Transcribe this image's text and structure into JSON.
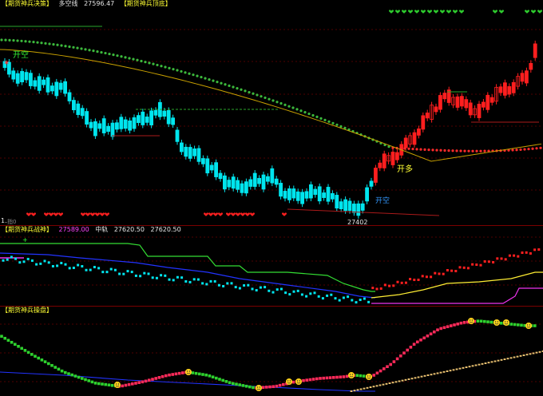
{
  "panel1": {
    "title": "【期货神兵决策】",
    "indicator_label": "多空线",
    "indicator_value": "27596.47",
    "subtitle": "【期货神兵顶底】",
    "open_short_label": "开空",
    "open_short_label_2": "开空",
    "open_long_label": "开多",
    "low_price_label": "27402",
    "corner_label": "1.",
    "corner_label_2": "指0"
  },
  "panel2": {
    "title": "【期货神兵战神】",
    "value1": "27589.00",
    "mid_label": "中轨",
    "mid_value": "27620.50",
    "value3": "27620.50"
  },
  "panel3": {
    "title": "【期货神兵操盘】"
  },
  "colors": {
    "up": "#ff1f1f",
    "down": "#00e5ee",
    "ma_green": "#3cb83c",
    "ma_red": "#ff2a2a",
    "long_line": "#c8a000",
    "grid": "#6a0000",
    "band_green": "#33dd33",
    "band_blue": "#2233ff",
    "band_yellow": "#ffee33",
    "band_magenta": "#ee33ee",
    "heart_red": "#ff2020",
    "heart_green": "#2ecc2e"
  }
}
